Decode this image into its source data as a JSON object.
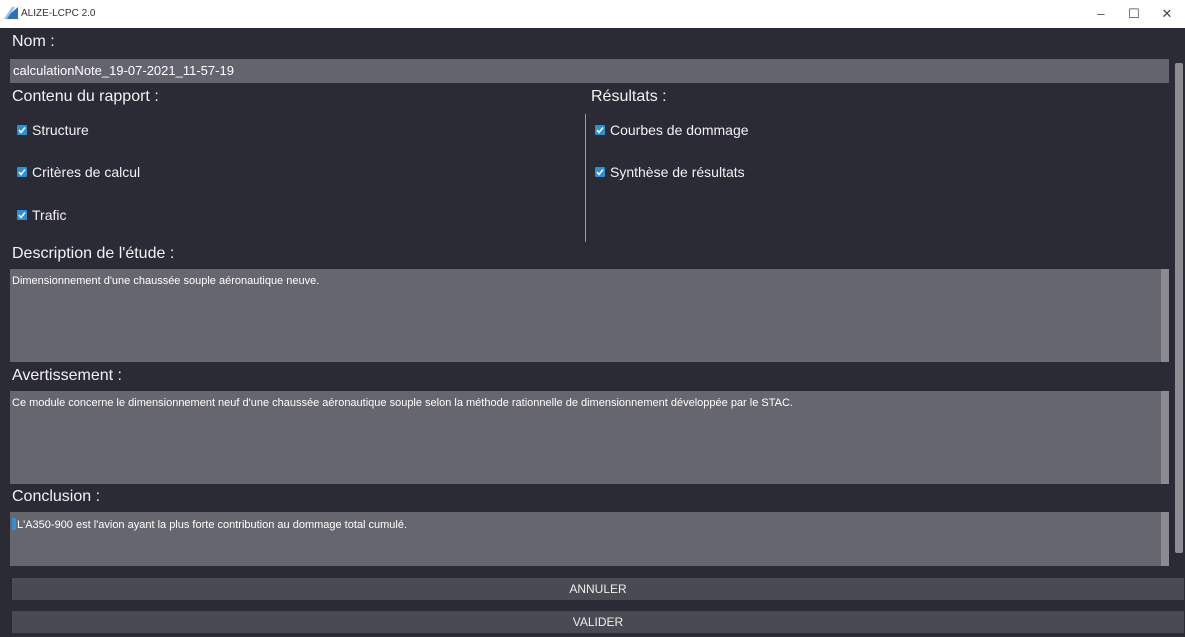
{
  "window": {
    "title": "ALIZE-LCPC 2.0",
    "minimize": "–",
    "maximize": "☐",
    "close": "✕"
  },
  "form": {
    "name_label": "Nom :",
    "name_value": "calculationNote_19-07-2021_11-57-19",
    "report_label": "Contenu du rapport :",
    "results_label": "Résultats :",
    "report_items": [
      "Structure",
      "Critères de calcul",
      "Trafic"
    ],
    "result_items": [
      "Courbes de dommage",
      "Synthèse de résultats"
    ],
    "description_label": "Description de l'étude :",
    "description_value": "Dimensionnement d'une chaussée souple aéronautique neuve.",
    "warning_label": "Avertissement :",
    "warning_value": "Ce module concerne le dimensionnement neuf d'une chaussée aéronautique souple selon la méthode rationnelle de dimensionnement développée par le STAC.",
    "conclusion_label": "Conclusion :",
    "conclusion_value": "L'A350-900 est l'avion ayant la plus forte contribution au dommage total cumulé."
  },
  "buttons": {
    "cancel": "ANNULER",
    "validate": "VALIDER"
  },
  "colors": {
    "accent": "#2d8ed9",
    "background": "#2b2b35",
    "field": "#64646e"
  }
}
